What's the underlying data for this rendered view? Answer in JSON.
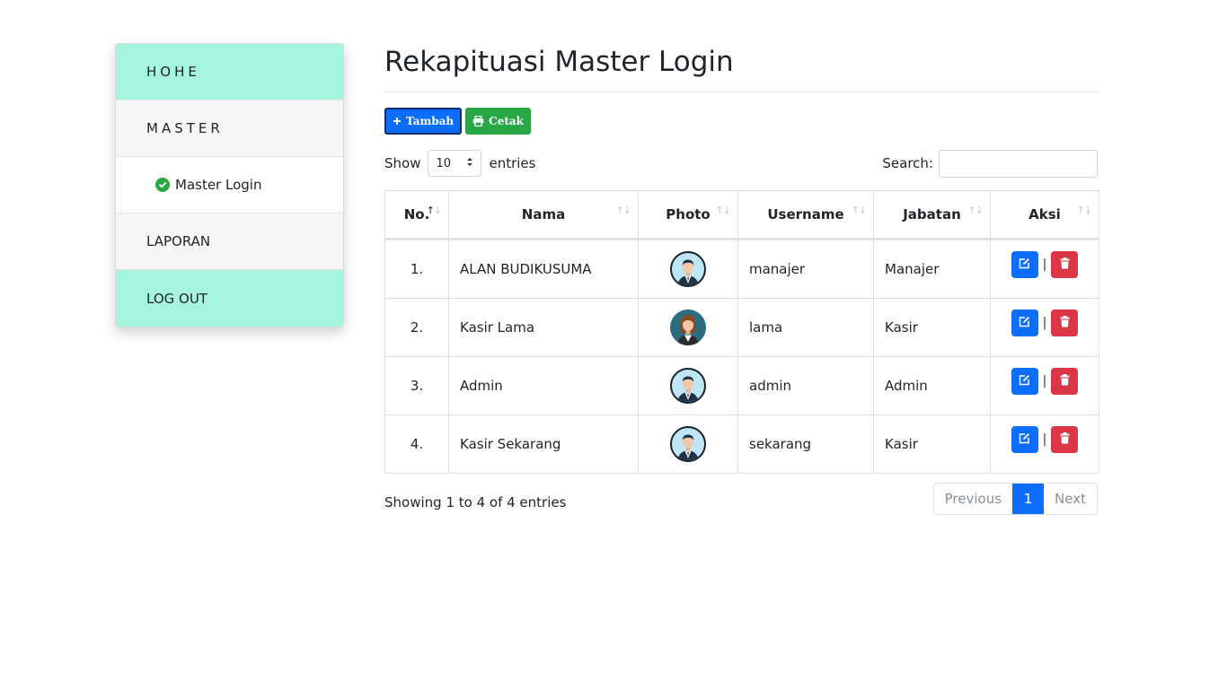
{
  "sidebar": {
    "items": [
      {
        "label": "HOHE"
      },
      {
        "label": "MASTER"
      },
      {
        "label": "Master Login"
      },
      {
        "label": "LAPORAN"
      },
      {
        "label": "LOG OUT"
      }
    ]
  },
  "page": {
    "title": "Rekapituasi Master Login"
  },
  "toolbar": {
    "add_label": "Tambah",
    "print_label": "Cetak"
  },
  "length": {
    "show_label": "Show",
    "value": "10",
    "entries_label": "entries"
  },
  "search": {
    "label": "Search:",
    "value": ""
  },
  "table": {
    "headers": [
      "No.",
      "Nama",
      "Photo",
      "Username",
      "Jabatan",
      "Aksi"
    ],
    "rows": [
      {
        "no": "1.",
        "nama": "ALAN BUDIKUSUMA",
        "photo": "male-avatar-icon",
        "username": "manajer",
        "jabatan": "Manajer"
      },
      {
        "no": "2.",
        "nama": "Kasir Lama",
        "photo": "female-avatar-icon",
        "username": "lama",
        "jabatan": "Kasir"
      },
      {
        "no": "3.",
        "nama": "Admin",
        "photo": "male-avatar-icon",
        "username": "admin",
        "jabatan": "Admin"
      },
      {
        "no": "4.",
        "nama": "Kasir Sekarang",
        "photo": "male-avatar-icon",
        "username": "sekarang",
        "jabatan": "Kasir"
      }
    ],
    "action_separator": "|"
  },
  "footer": {
    "info": "Showing 1 to 4 of 4 entries"
  },
  "pagination": {
    "previous": "Previous",
    "current": "1",
    "next": "Next"
  },
  "colors": {
    "sidebar_teal": "#a5f5df",
    "primary": "#0d6efd",
    "success": "#28a745",
    "danger": "#dc3545"
  }
}
